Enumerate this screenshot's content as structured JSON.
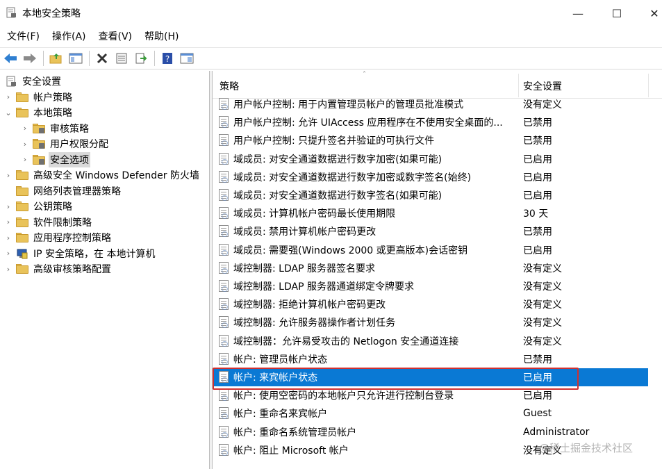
{
  "window": {
    "title": "本地安全策略",
    "controls": {
      "minimize": "—",
      "maximize": "☐",
      "close": "✕"
    }
  },
  "menu": [
    "文件(F)",
    "操作(A)",
    "查看(V)",
    "帮助(H)"
  ],
  "toolbar": [
    "back-icon",
    "forward-icon",
    "up-folder-icon",
    "show-pane-icon",
    "delete-icon",
    "properties-icon",
    "export-icon",
    "help-icon",
    "view-icon"
  ],
  "tree": [
    {
      "label": "安全设置",
      "level": 0,
      "chevron": "",
      "icon": "security-settings-icon"
    },
    {
      "label": "帐户策略",
      "level": 1,
      "chevron": "›",
      "icon": "folder-icon"
    },
    {
      "label": "本地策略",
      "level": 1,
      "chevron": "⌄",
      "icon": "folder-icon"
    },
    {
      "label": "审核策略",
      "level": 2,
      "chevron": "›",
      "icon": "folder-icon"
    },
    {
      "label": "用户权限分配",
      "level": 2,
      "chevron": "›",
      "icon": "folder-icon"
    },
    {
      "label": "安全选项",
      "level": 2,
      "chevron": "›",
      "icon": "folder-icon",
      "selected": true
    },
    {
      "label": "高级安全 Windows Defender 防火墙",
      "level": 1,
      "chevron": "›",
      "icon": "folder-icon"
    },
    {
      "label": "网络列表管理器策略",
      "level": 1,
      "chevron": "",
      "icon": "folder-icon"
    },
    {
      "label": "公钥策略",
      "level": 1,
      "chevron": "›",
      "icon": "folder-icon"
    },
    {
      "label": "软件限制策略",
      "level": 1,
      "chevron": "›",
      "icon": "folder-icon"
    },
    {
      "label": "应用程序控制策略",
      "level": 1,
      "chevron": "›",
      "icon": "folder-icon"
    },
    {
      "label": "IP 安全策略，在 本地计算机",
      "level": 1,
      "chevron": "›",
      "icon": "ip-security-icon"
    },
    {
      "label": "高级审核策略配置",
      "level": 1,
      "chevron": "›",
      "icon": "folder-icon"
    }
  ],
  "list": {
    "columns": {
      "policy": "策略",
      "setting": "安全设置"
    },
    "sort_indicator": "˄",
    "rows": [
      {
        "policy": "用户帐户控制: 用于内置管理员帐户的管理员批准模式",
        "setting": "没有定义"
      },
      {
        "policy": "用户帐户控制: 允许 UIAccess 应用程序在不使用安全桌面的...",
        "setting": "已禁用"
      },
      {
        "policy": "用户帐户控制: 只提升签名并验证的可执行文件",
        "setting": "已禁用"
      },
      {
        "policy": "域成员: 对安全通道数据进行数字加密(如果可能)",
        "setting": "已启用"
      },
      {
        "policy": "域成员: 对安全通道数据进行数字加密或数字签名(始终)",
        "setting": "已启用"
      },
      {
        "policy": "域成员: 对安全通道数据进行数字签名(如果可能)",
        "setting": "已启用"
      },
      {
        "policy": "域成员: 计算机帐户密码最长使用期限",
        "setting": "30 天"
      },
      {
        "policy": "域成员: 禁用计算机帐户密码更改",
        "setting": "已禁用"
      },
      {
        "policy": "域成员: 需要强(Windows 2000 或更高版本)会话密钥",
        "setting": "已启用"
      },
      {
        "policy": "域控制器: LDAP 服务器签名要求",
        "setting": "没有定义"
      },
      {
        "policy": "域控制器: LDAP 服务器通道绑定令牌要求",
        "setting": "没有定义"
      },
      {
        "policy": "域控制器: 拒绝计算机帐户密码更改",
        "setting": "没有定义"
      },
      {
        "policy": "域控制器: 允许服务器操作者计划任务",
        "setting": "没有定义"
      },
      {
        "policy": "域控制器：允许易受攻击的 Netlogon 安全通道连接",
        "setting": "没有定义"
      },
      {
        "policy": "帐户: 管理员帐户状态",
        "setting": "已禁用"
      },
      {
        "policy": "帐户: 来宾帐户状态",
        "setting": "已启用",
        "selected": true
      },
      {
        "policy": "帐户: 使用空密码的本地帐户只允许进行控制台登录",
        "setting": "已启用"
      },
      {
        "policy": "帐户: 重命名来宾帐户",
        "setting": "Guest"
      },
      {
        "policy": "帐户: 重命名系统管理员帐户",
        "setting": "Administrator"
      },
      {
        "policy": "帐户: 阻止 Microsoft 帐户",
        "setting": "没有定义"
      }
    ]
  },
  "watermark": "@稀土掘金技术社区",
  "colors": {
    "selection": "#0a79d4",
    "highlight_border": "#d03030",
    "folder": "#e9c35a"
  }
}
